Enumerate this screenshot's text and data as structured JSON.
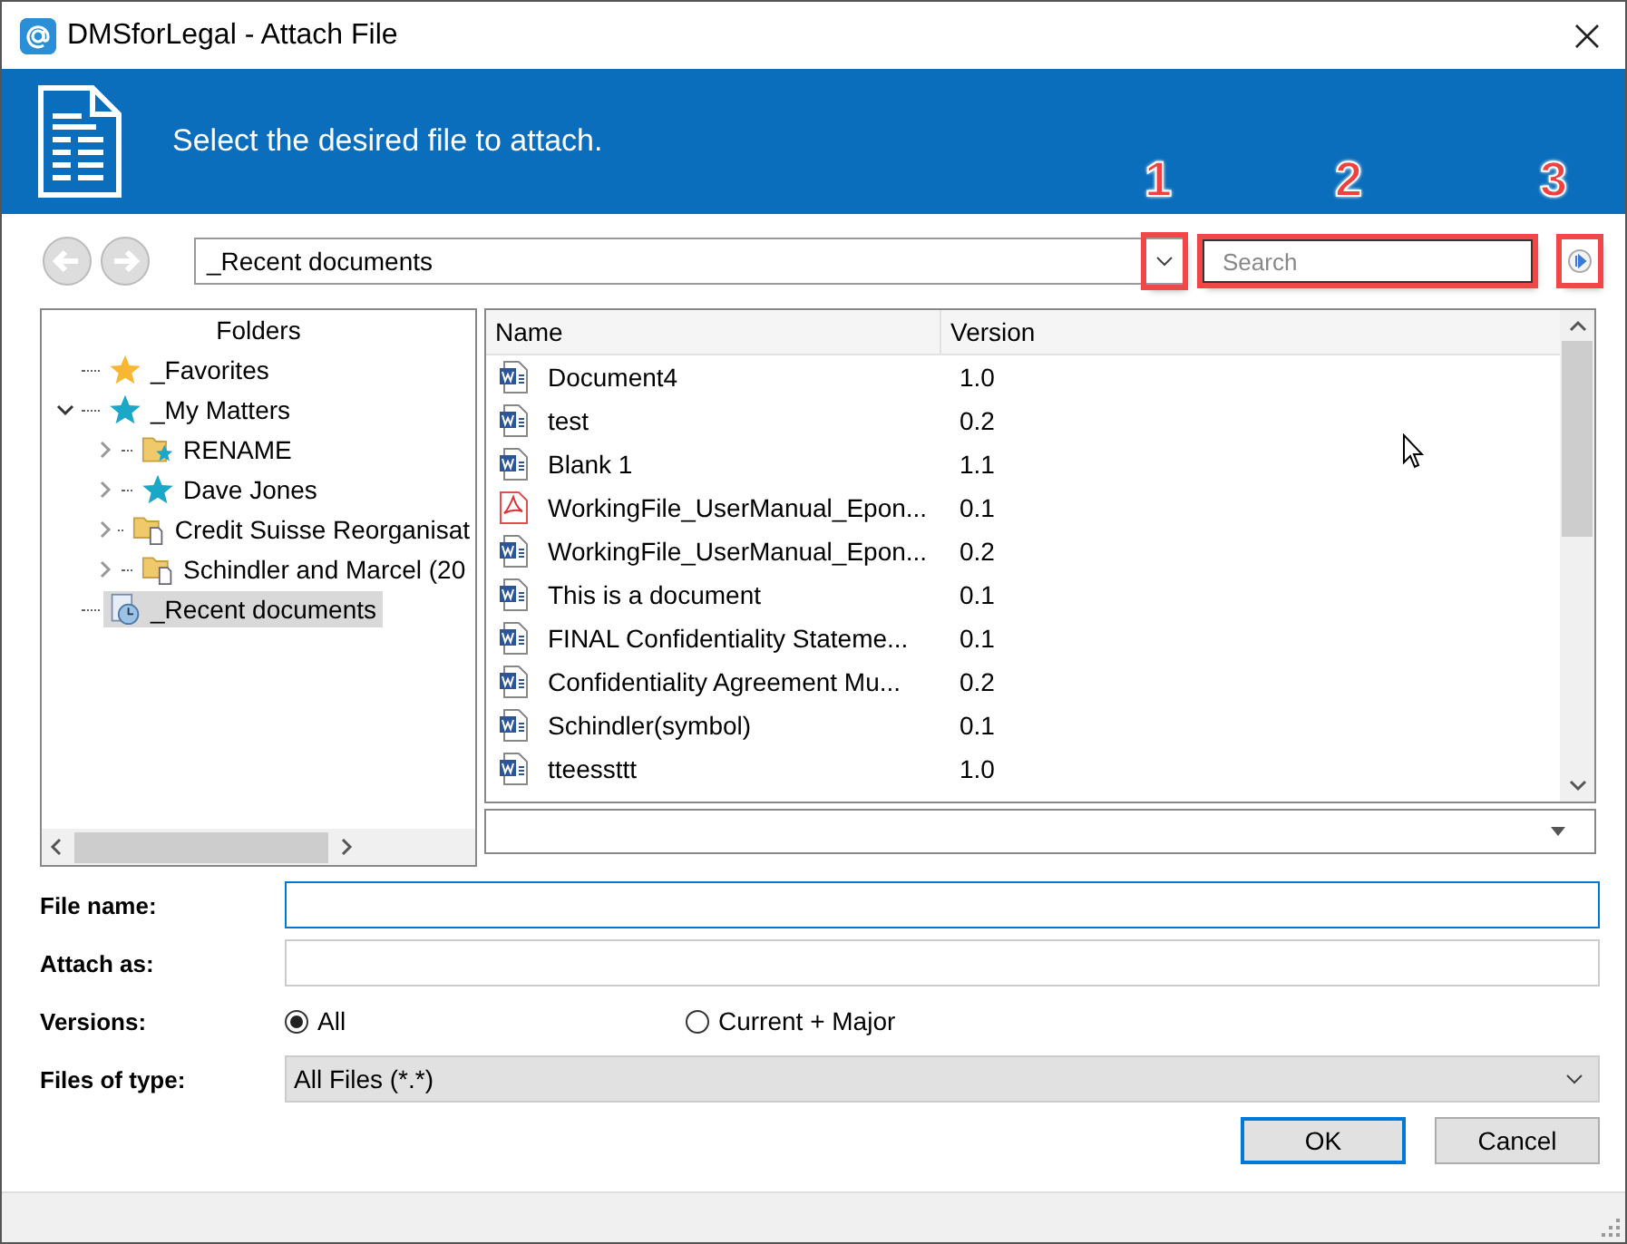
{
  "window": {
    "title": "DMSforLegal - Attach File"
  },
  "banner": {
    "text": "Select the desired file to attach."
  },
  "callouts": [
    "1",
    "2",
    "3"
  ],
  "location": {
    "value": "_Recent documents"
  },
  "search": {
    "placeholder": "Search"
  },
  "folders": {
    "title": "Folders",
    "items": [
      {
        "label": "_Favorites",
        "kind": "star-gold",
        "selected": false
      },
      {
        "label": "_My Matters",
        "kind": "star-teal",
        "selected": false,
        "expanded": true,
        "children": [
          {
            "label": "RENAME",
            "kind": "folder-star",
            "selected": false,
            "expanded": false
          },
          {
            "label": "Dave Jones",
            "kind": "star-teal",
            "selected": false,
            "expanded": false
          },
          {
            "label": "Credit Suisse Reorganisat",
            "kind": "folder-doc",
            "selected": false,
            "expanded": false
          },
          {
            "label": "Schindler and Marcel (20",
            "kind": "folder-doc",
            "selected": false,
            "expanded": false
          }
        ]
      },
      {
        "label": "_Recent documents",
        "kind": "recent",
        "selected": true
      }
    ]
  },
  "files": {
    "columns": [
      "Name",
      "Version"
    ],
    "rows": [
      {
        "name": "Document4",
        "version": "1.0",
        "kind": "word"
      },
      {
        "name": "test",
        "version": "0.2",
        "kind": "word"
      },
      {
        "name": "Blank 1",
        "version": "1.1",
        "kind": "word"
      },
      {
        "name": "WorkingFile_UserManual_Epon...",
        "version": "0.1",
        "kind": "pdf"
      },
      {
        "name": "WorkingFile_UserManual_Epon...",
        "version": "0.2",
        "kind": "word"
      },
      {
        "name": "This is a document",
        "version": "0.1",
        "kind": "word"
      },
      {
        "name": "FINAL Confidentiality Stateme...",
        "version": "0.1",
        "kind": "word"
      },
      {
        "name": "Confidentiality Agreement Mu...",
        "version": "0.2",
        "kind": "word"
      },
      {
        "name": "Schindler(symbol)",
        "version": "0.1",
        "kind": "word"
      },
      {
        "name": "tteessttt",
        "version": "1.0",
        "kind": "word"
      }
    ]
  },
  "form": {
    "file_name_label": "File name:",
    "attach_as_label": "Attach as:",
    "versions_label": "Versions:",
    "versions": [
      {
        "label": "All",
        "selected": true
      },
      {
        "label": "Current + Major",
        "selected": false
      }
    ],
    "file_type_label": "Files of type:",
    "file_type": "All Files (*.*)"
  },
  "buttons": [
    {
      "label": "OK",
      "default": true
    },
    {
      "label": "Cancel",
      "default": false
    }
  ]
}
